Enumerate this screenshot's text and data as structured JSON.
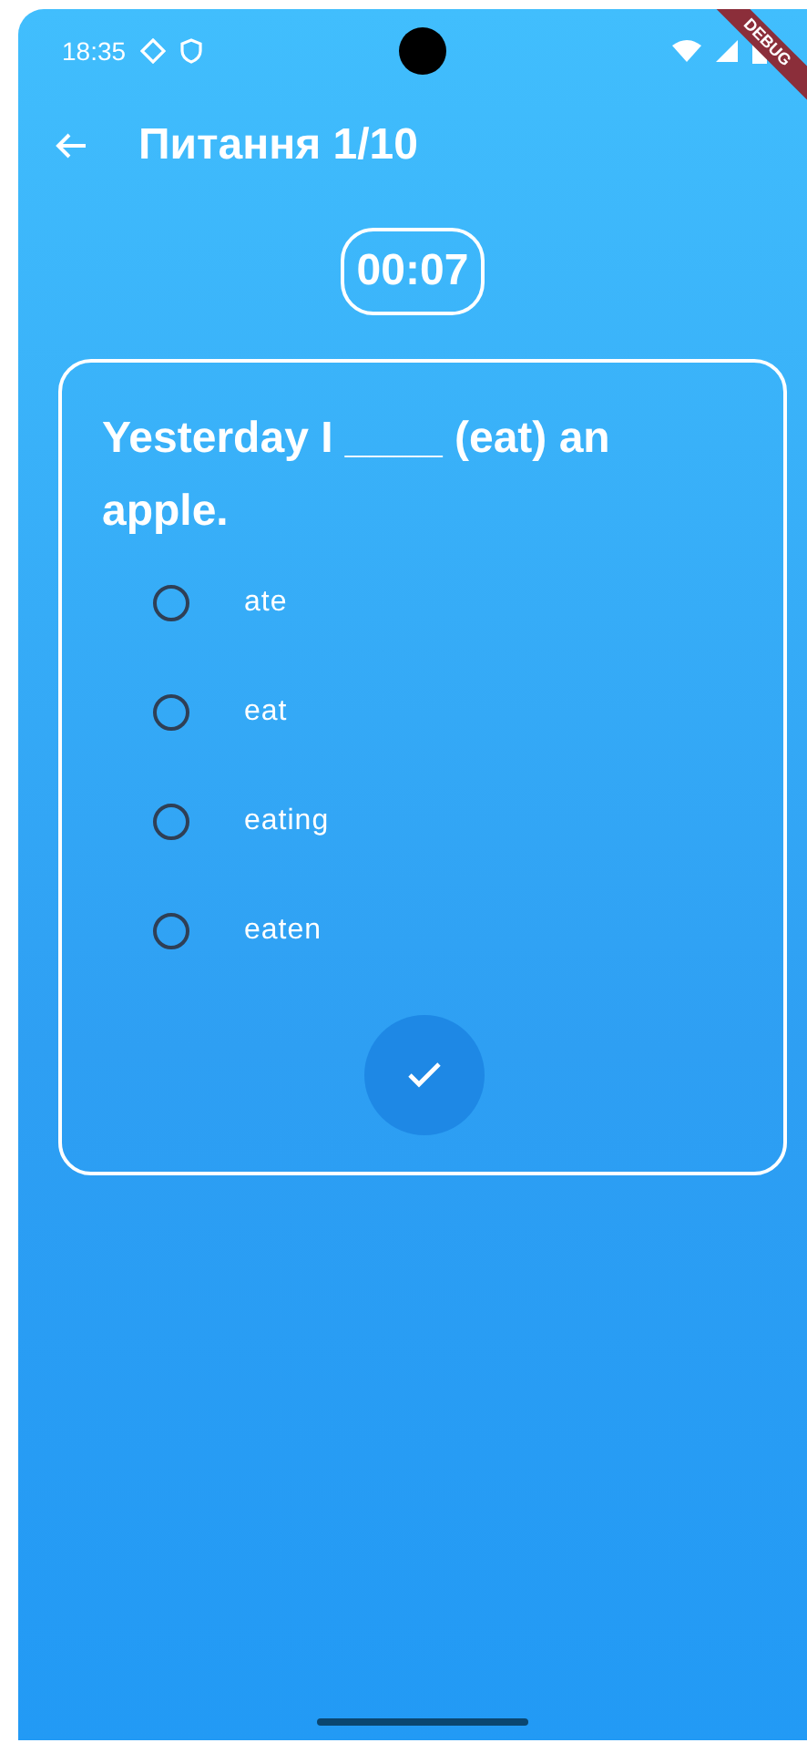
{
  "status_bar": {
    "time": "18:35"
  },
  "debug_banner": "DEBUG",
  "app_bar": {
    "title": "Питання 1/10"
  },
  "timer": "00:07",
  "question": {
    "text": "Yesterday I ____ (eat) an apple.",
    "options": [
      {
        "label": "ate",
        "selected": false
      },
      {
        "label": "eat",
        "selected": false
      },
      {
        "label": "eating",
        "selected": false
      },
      {
        "label": "eaten",
        "selected": false
      }
    ]
  }
}
